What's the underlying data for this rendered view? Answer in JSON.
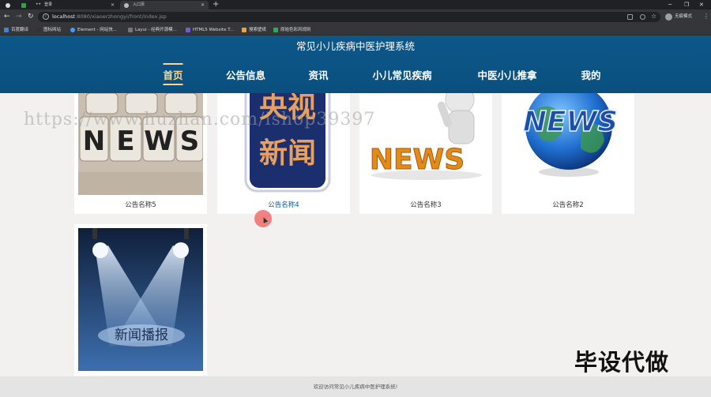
{
  "browser": {
    "tabs": [
      {
        "title": "",
        "icon": "page-icon"
      },
      {
        "title": "",
        "icon": "green-app-icon"
      },
      {
        "title": "登录",
        "icon": "dots-icon"
      },
      {
        "title": "入口页",
        "icon": "globe-icon"
      }
    ],
    "address": {
      "host": "localhost",
      "path": ":8080/xiaoerzhongyi/front/index.jsp"
    },
    "profile_label": "无痕模式",
    "bookmarks": [
      "百度翻译",
      "图标网站",
      "Element - 网站快...",
      "Layui - 经典开源模...",
      "HTML5 Website T...",
      "搜索壁纸",
      "原始色彩风规则"
    ]
  },
  "site": {
    "title": "常见小儿疾病中医护理系统",
    "nav": [
      "首页",
      "公告信息",
      "资讯",
      "小儿常见疾病",
      "中医小儿推拿",
      "我的"
    ],
    "active_nav": "首页"
  },
  "cards": [
    {
      "caption": "公告名称5",
      "image_text": "NEWS"
    },
    {
      "caption": "公告名称4",
      "image_text": [
        "央视",
        "新闻"
      ]
    },
    {
      "caption": "公告名称3",
      "image_text": "NEWS"
    },
    {
      "caption": "公告名称2",
      "image_text": "NEWS"
    },
    {
      "caption": "",
      "image_text": "新闻播报"
    }
  ],
  "watermark": "https://www.huzhan.com/ishop39397",
  "stamp": "毕设代做",
  "footer": "欢迎访问常见小儿疾病中医护理系统!",
  "colors": {
    "header": "#0d5789",
    "active": "#ffd38a",
    "page_bg": "#f3f1f0"
  }
}
